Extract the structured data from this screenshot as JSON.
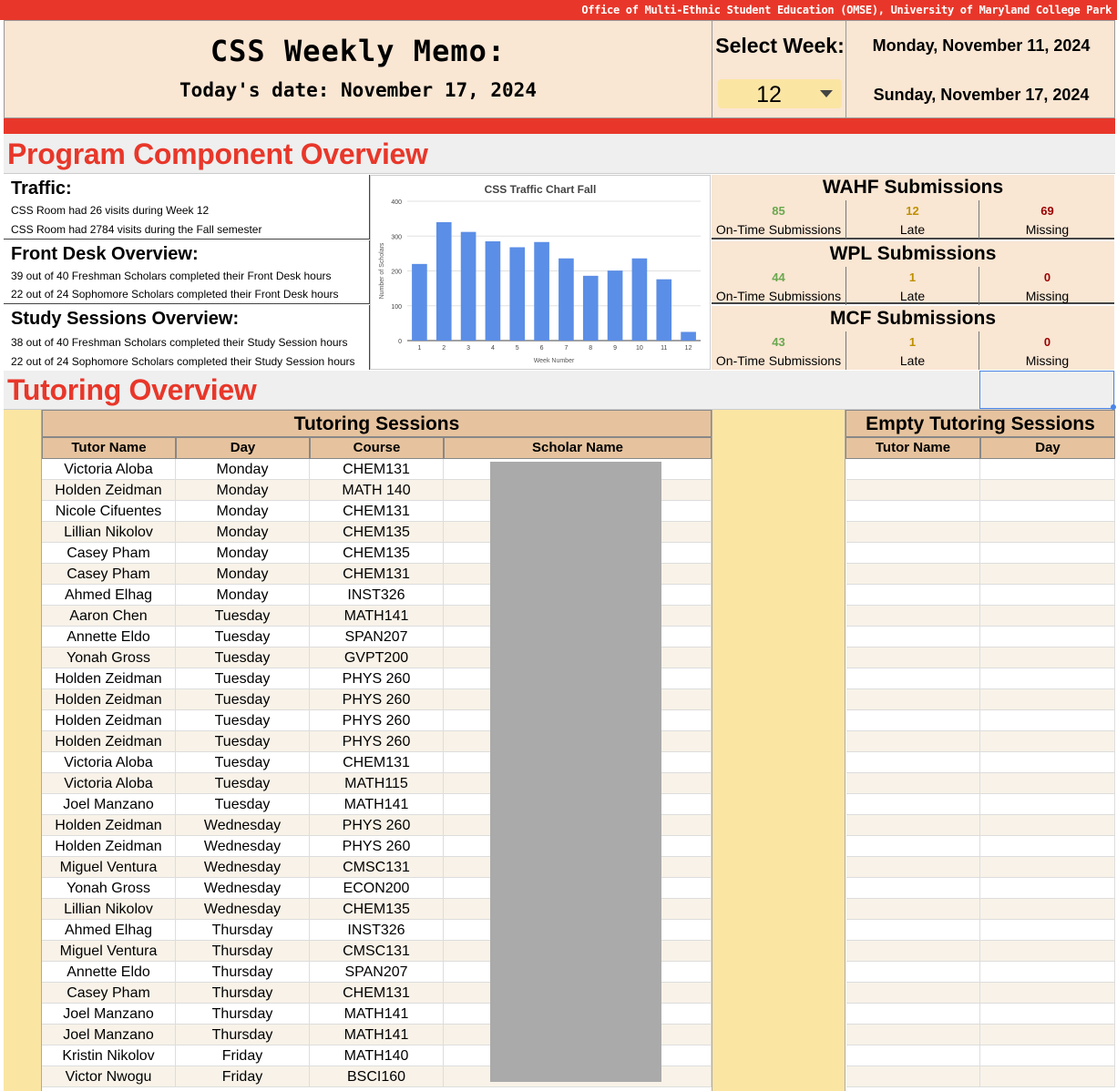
{
  "banner": {
    "text": "Office of Multi-Ethnic Student Education (OMSE), University of Maryland College Park"
  },
  "header": {
    "title": "CSS Weekly Memo:",
    "today": "Today's date: November 17, 2024",
    "select_week_label": "Select Week:",
    "selected_week": "12",
    "week_start": "Monday, November 11, 2024",
    "week_end": "Sunday, November 17, 2024"
  },
  "program": {
    "title": "Program Component Overview",
    "traffic": {
      "title": "Traffic:",
      "line1": "CSS Room had 26 visits during Week 12",
      "line2": "CSS Room had 2784 visits during the Fall semester"
    },
    "front_desk": {
      "title": "Front Desk Overview:",
      "line1": "39 out of 40 Freshman Scholars completed their Front Desk hours",
      "line2": "22 out of 24 Sophomore Scholars completed their Front Desk hours"
    },
    "study": {
      "title": "Study Sessions Overview:",
      "line1": "38 out of 40 Freshman Scholars completed their Study Session hours",
      "line2": "22 out of 24 Sophomore Scholars completed their Study Session hours"
    },
    "submissions": [
      {
        "title": "WAHF Submissions",
        "on_time": "85",
        "late": "12",
        "missing": "69",
        "on_time_label": "On-Time Submissions",
        "late_label": "Late",
        "missing_label": "Missing"
      },
      {
        "title": "WPL Submissions",
        "on_time": "44",
        "late": "1",
        "missing": "0",
        "on_time_label": "On-Time Submissions",
        "late_label": "Late",
        "missing_label": "Missing"
      },
      {
        "title": "MCF Submissions",
        "on_time": "43",
        "late": "1",
        "missing": "0",
        "on_time_label": "On-Time Submissions",
        "late_label": "Late",
        "missing_label": "Missing"
      }
    ]
  },
  "chart_data": {
    "type": "bar",
    "title": "CSS Traffic Chart Fall",
    "xlabel": "Week Number",
    "ylabel": "Number of Scholars",
    "categories": [
      "1",
      "2",
      "3",
      "4",
      "5",
      "6",
      "7",
      "8",
      "9",
      "10",
      "11",
      "12"
    ],
    "values": [
      220,
      340,
      312,
      285,
      268,
      283,
      236,
      186,
      201,
      236,
      176,
      25
    ],
    "ylim": [
      0,
      400
    ],
    "yticks": [
      0,
      100,
      200,
      300,
      400
    ],
    "color": "#5b8ee6",
    "grid": true
  },
  "tutoring": {
    "title": "Tutoring Overview",
    "sessions_title": "Tutoring Sessions",
    "headers": [
      "Tutor Name",
      "Day",
      "Course",
      "Scholar Name"
    ],
    "empty_title": "Empty Tutoring Sessions",
    "empty_headers": [
      "Tutor Name",
      "Day"
    ],
    "rows": [
      [
        "Victoria Aloba",
        "Monday",
        "CHEM131"
      ],
      [
        "Holden Zeidman",
        "Monday",
        "MATH 140"
      ],
      [
        "Nicole Cifuentes",
        "Monday",
        "CHEM131"
      ],
      [
        "Lillian Nikolov",
        "Monday",
        "CHEM135"
      ],
      [
        "Casey Pham",
        "Monday",
        "CHEM135"
      ],
      [
        "Casey Pham",
        "Monday",
        "CHEM131"
      ],
      [
        "Ahmed Elhag",
        "Monday",
        "INST326"
      ],
      [
        "Aaron Chen",
        "Tuesday",
        "MATH141"
      ],
      [
        "Annette Eldo",
        "Tuesday",
        "SPAN207"
      ],
      [
        "Yonah Gross",
        "Tuesday",
        "GVPT200"
      ],
      [
        "Holden Zeidman",
        "Tuesday",
        "PHYS 260"
      ],
      [
        "Holden Zeidman",
        "Tuesday",
        "PHYS 260"
      ],
      [
        "Holden Zeidman",
        "Tuesday",
        "PHYS 260"
      ],
      [
        "Holden Zeidman",
        "Tuesday",
        "PHYS 260"
      ],
      [
        "Victoria Aloba",
        "Tuesday",
        "CHEM131"
      ],
      [
        "Victoria Aloba",
        "Tuesday",
        "MATH115"
      ],
      [
        "Joel Manzano",
        "Tuesday",
        "MATH141"
      ],
      [
        "Holden Zeidman",
        "Wednesday",
        "PHYS 260"
      ],
      [
        "Holden Zeidman",
        "Wednesday",
        "PHYS 260"
      ],
      [
        "Miguel Ventura",
        "Wednesday",
        "CMSC131"
      ],
      [
        "Yonah Gross",
        "Wednesday",
        "ECON200"
      ],
      [
        "Lillian Nikolov",
        "Wednesday",
        "CHEM135"
      ],
      [
        "Ahmed Elhag",
        "Thursday",
        "INST326"
      ],
      [
        "Miguel Ventura",
        "Thursday",
        "CMSC131"
      ],
      [
        "Annette Eldo",
        "Thursday",
        "SPAN207"
      ],
      [
        "Casey Pham",
        "Thursday",
        "CHEM131"
      ],
      [
        "Joel Manzano",
        "Thursday",
        "MATH141"
      ],
      [
        "Joel Manzano",
        "Thursday",
        "MATH141"
      ],
      [
        "Kristin Nikolov",
        "Friday",
        "MATH140"
      ],
      [
        "Victor Nwogu",
        "Friday",
        "BSCI160"
      ]
    ]
  }
}
